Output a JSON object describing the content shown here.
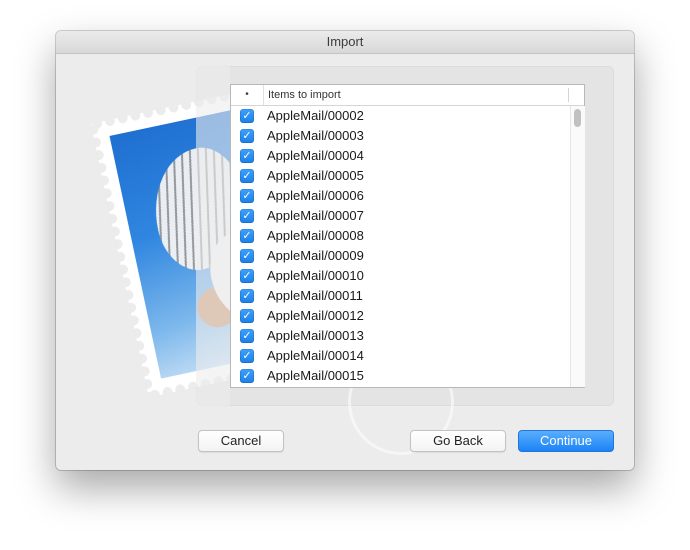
{
  "window": {
    "title": "Import"
  },
  "list": {
    "sort_indicator": "•",
    "column_header": "Items to import",
    "check_glyph": "✓",
    "items": [
      {
        "label": "AppleMail/00002",
        "checked": true
      },
      {
        "label": "AppleMail/00003",
        "checked": true
      },
      {
        "label": "AppleMail/00004",
        "checked": true
      },
      {
        "label": "AppleMail/00005",
        "checked": true
      },
      {
        "label": "AppleMail/00006",
        "checked": true
      },
      {
        "label": "AppleMail/00007",
        "checked": true
      },
      {
        "label": "AppleMail/00008",
        "checked": true
      },
      {
        "label": "AppleMail/00009",
        "checked": true
      },
      {
        "label": "AppleMail/00010",
        "checked": true
      },
      {
        "label": "AppleMail/00011",
        "checked": true
      },
      {
        "label": "AppleMail/00012",
        "checked": true
      },
      {
        "label": "AppleMail/00013",
        "checked": true
      },
      {
        "label": "AppleMail/00014",
        "checked": true
      },
      {
        "label": "AppleMail/00015",
        "checked": true
      }
    ]
  },
  "buttons": {
    "cancel": "Cancel",
    "go_back": "Go Back",
    "continue": "Continue"
  },
  "colors": {
    "accent": "#1b83f7",
    "checkbox": "#2a8ff5"
  },
  "icons": {
    "stamp": "mail-stamp-icon"
  }
}
